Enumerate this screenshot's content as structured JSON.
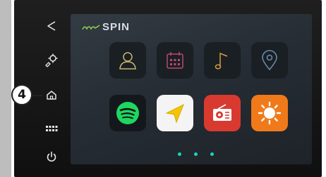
{
  "callout": {
    "number": "4"
  },
  "brand": {
    "logo_text": "SPIN",
    "logo_mark": "my"
  },
  "sidebar": {
    "items": [
      {
        "name": "back",
        "icon": "back-triangle-icon"
      },
      {
        "name": "settings",
        "icon": "settings-icon"
      },
      {
        "name": "home",
        "icon": "home-icon"
      },
      {
        "name": "menu",
        "icon": "grid-menu-icon"
      },
      {
        "name": "power",
        "icon": "power-icon"
      }
    ]
  },
  "apps": [
    {
      "name": "contacts",
      "icon": "contacts-icon",
      "color": "#1a1f24"
    },
    {
      "name": "calendar",
      "icon": "calendar-icon",
      "color": "#1a1f24"
    },
    {
      "name": "music",
      "icon": "music-note-icon",
      "color": "#1a1f24"
    },
    {
      "name": "navigation",
      "icon": "location-pin-icon",
      "color": "#1a1f24"
    },
    {
      "name": "spotify",
      "icon": "spotify-icon",
      "color": "#1ed760"
    },
    {
      "name": "nav-app",
      "icon": "navigation-arrow-icon",
      "color": "#f5c400"
    },
    {
      "name": "radio",
      "icon": "radio-icon",
      "color": "#d93a30"
    },
    {
      "name": "weather",
      "icon": "sun-icon",
      "color": "#f07a1a"
    }
  ],
  "pager": {
    "pages": 3
  }
}
